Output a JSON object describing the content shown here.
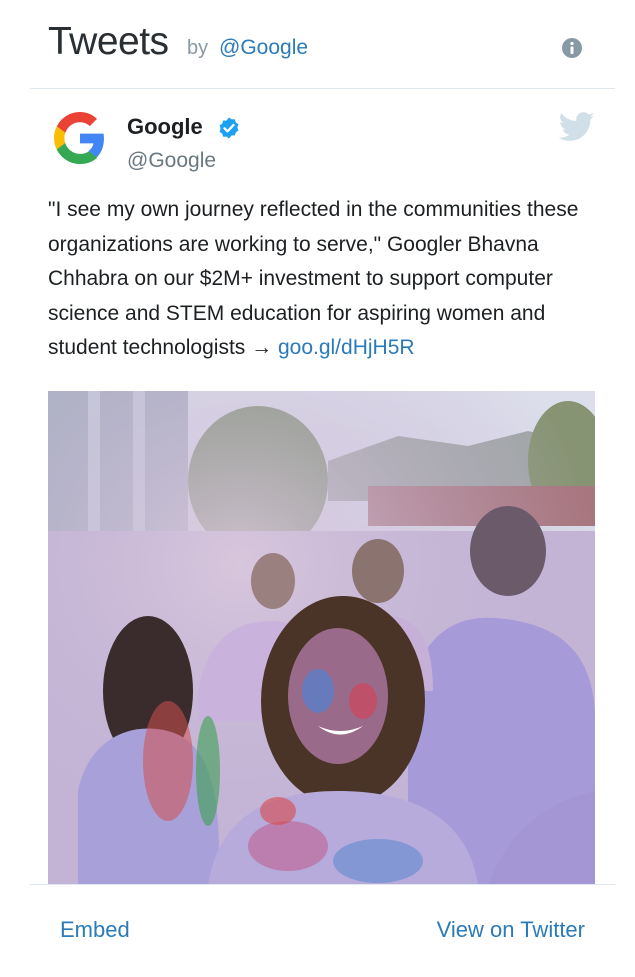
{
  "header": {
    "title": "Tweets",
    "by": "by",
    "handle": "@Google"
  },
  "tweet": {
    "author": {
      "name": "Google",
      "handle": "@Google",
      "verified": true
    },
    "text": "\"I see my own journey reflected in the communities these organizations are working to serve,\" Googler Bhavna Chhabra on our $2M+ investment to support computer science and STEM education for aspiring women and student technologists → ",
    "link": "goo.gl/dHjH5R"
  },
  "footer": {
    "embed_label": "Embed",
    "view_label": "View on Twitter"
  },
  "colors": {
    "link": "#2b7bb9",
    "verified": "#1da1f2",
    "divider": "#e1e8ed"
  },
  "icons": [
    "info-icon",
    "google-logo-icon",
    "verified-badge-icon",
    "twitter-bird-icon"
  ]
}
